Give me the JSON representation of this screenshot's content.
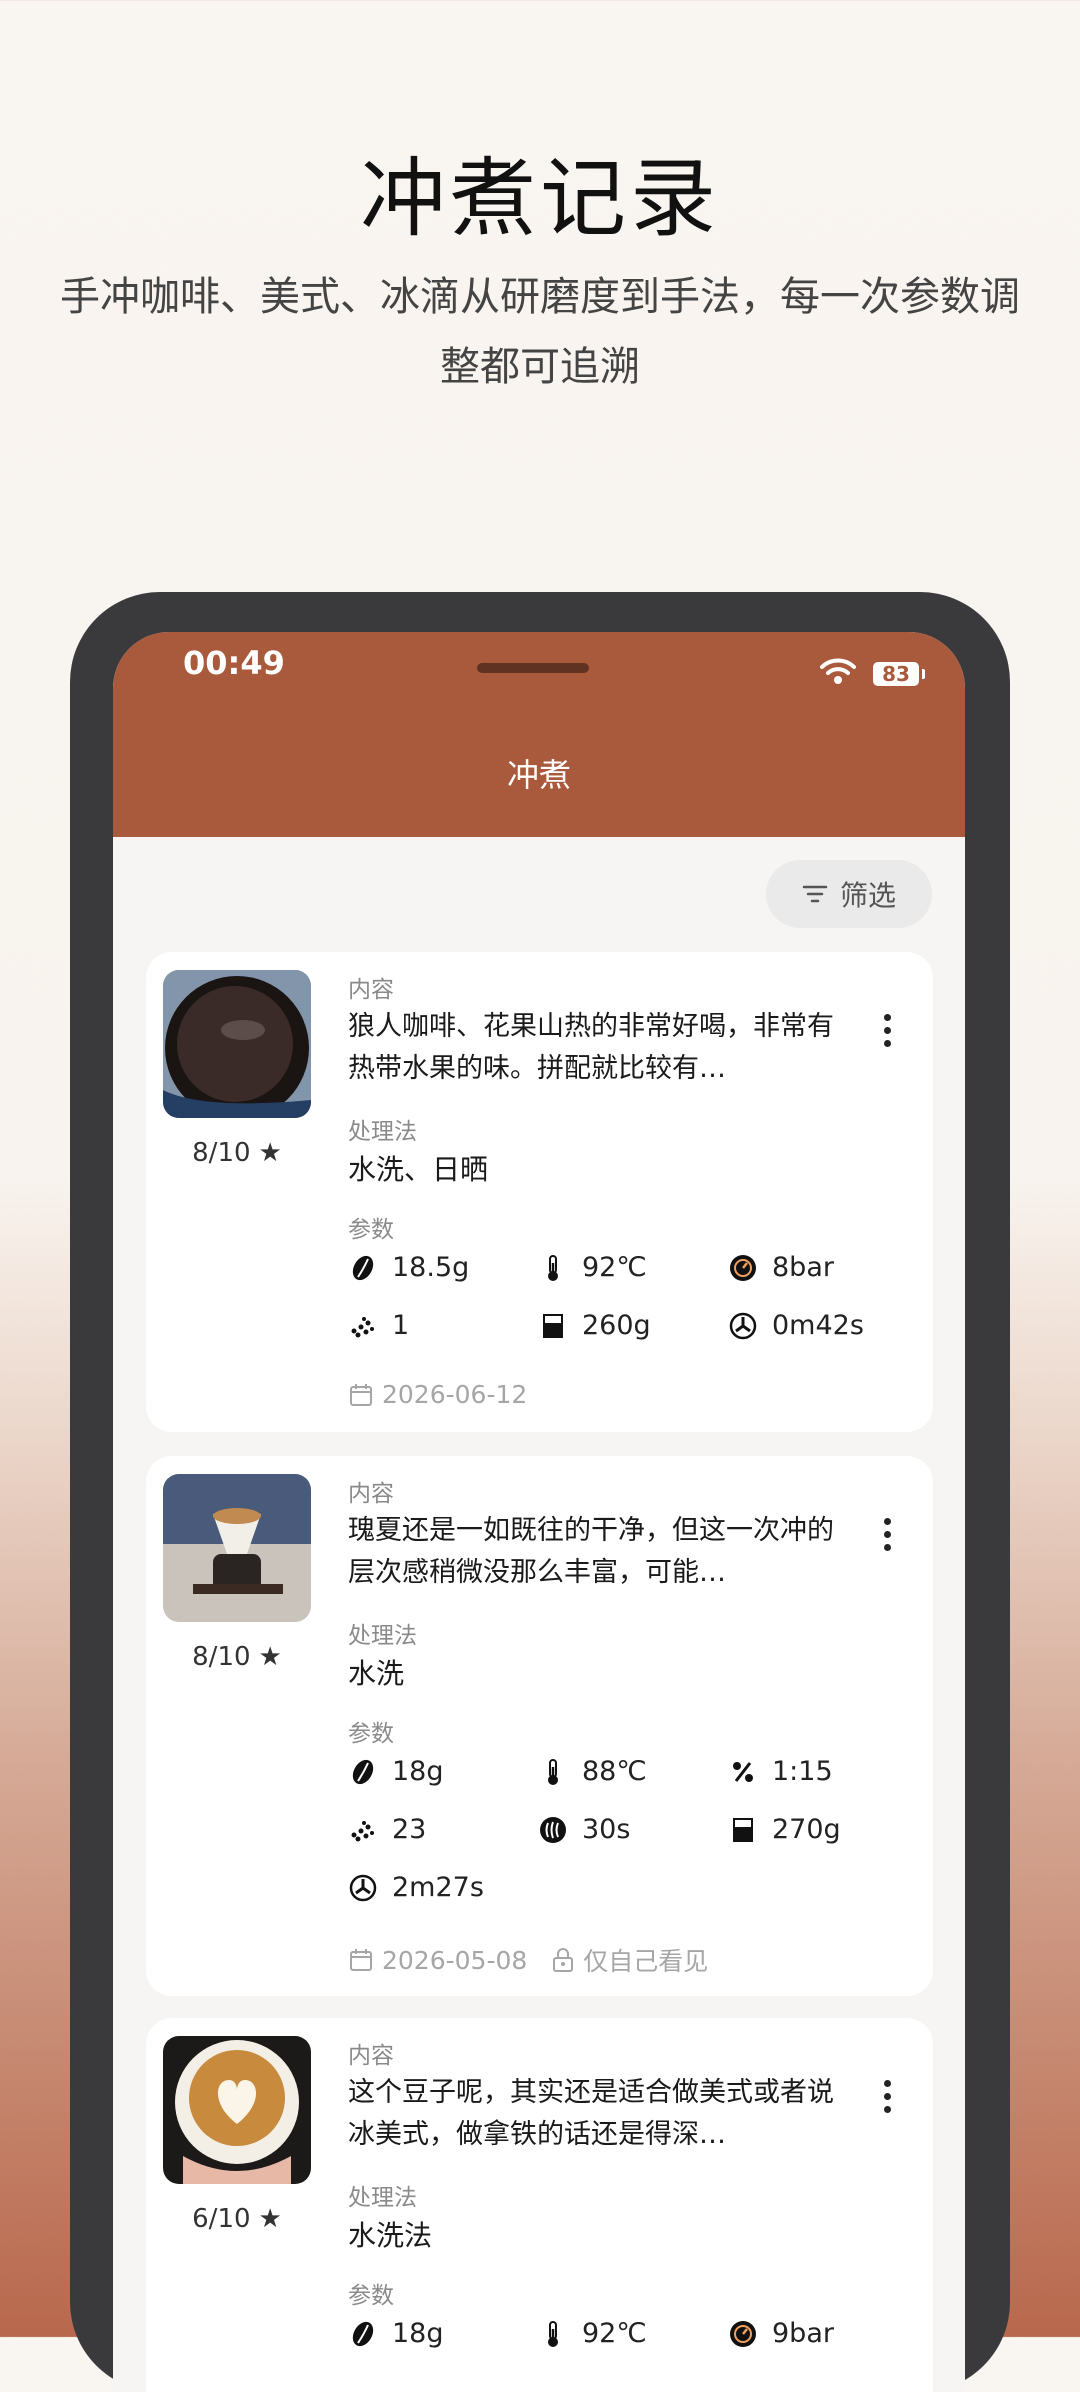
{
  "promo": {
    "title": "冲煮记录",
    "subtitle": "手冲咖啡、美式、冰滴从研磨度到手法，每一次参数调整都可追溯"
  },
  "status_bar": {
    "time": "00:49",
    "battery": "83"
  },
  "app_bar": {
    "title": "冲煮"
  },
  "filter": {
    "label": "筛选"
  },
  "labels": {
    "content": "内容",
    "process": "处理法",
    "params": "参数"
  },
  "records": [
    {
      "rating": "8/10",
      "content": "狼人咖啡、花果山热的非常好喝，非常有热带水果的味。拼配就比较有…",
      "process": "水洗、日晒",
      "params": {
        "dose": "18.5g",
        "temp": "92℃",
        "pressure": "8bar",
        "grind": "1",
        "water": "260g",
        "time": "0m42s"
      },
      "date": "2026-06-12"
    },
    {
      "rating": "8/10",
      "content": "瑰夏还是一如既往的干净，但这一次冲的层次感稍微没那么丰富，可能…",
      "process": "水洗",
      "params": {
        "dose": "18g",
        "temp": "88℃",
        "ratio": "1:15",
        "grind": "23",
        "bloom": "30s",
        "water": "270g",
        "time": "2m27s"
      },
      "date": "2026-05-08",
      "privacy": "仅自己看见"
    },
    {
      "rating": "6/10",
      "content": "这个豆子呢，其实还是适合做美式或者说冰美式，做拿铁的话还是得深…",
      "process": "水洗法",
      "params": {
        "dose": "18g",
        "temp": "92℃",
        "pressure": "9bar"
      }
    }
  ],
  "colors": {
    "brand": "#a95a3c",
    "card": "#ffffff",
    "screen_bg": "#f6f5f4"
  }
}
